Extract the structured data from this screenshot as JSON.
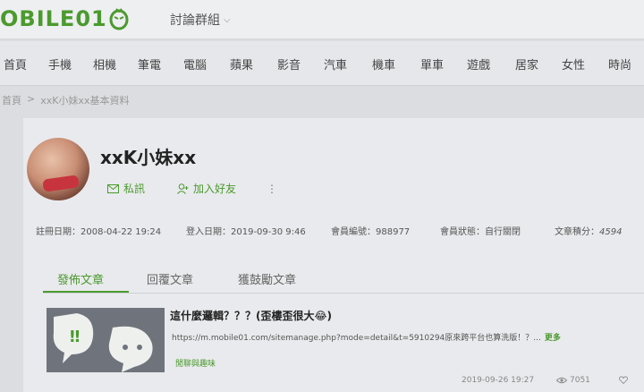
{
  "header": {
    "logo_text": "OBILE01",
    "logo_color": "#4b9a2e",
    "forum_groups_label": "討論群組"
  },
  "nav": {
    "items": [
      "首頁",
      "手機",
      "相機",
      "筆電",
      "電腦",
      "蘋果",
      "影音",
      "汽車",
      "機車",
      "單車",
      "遊戲",
      "居家",
      "女性",
      "時尚"
    ]
  },
  "breadcrumb": {
    "home": "首頁",
    "separator": ">",
    "current": "xxK小妹xx基本資料"
  },
  "profile": {
    "username": "xxK小妹xx",
    "message_label": "私訊",
    "add_friend_label": "加入好友",
    "more_label": "⋮"
  },
  "stats": {
    "register": "註冊日期：2008-04-22 19:24",
    "login": "登入日期：2019-09-30 9:46",
    "member_id": "會員編號：988977",
    "status": "會員狀態：自行關閉",
    "score_label": "文章積分：",
    "score_value": "4594"
  },
  "tabs": {
    "items": [
      "發佈文章",
      "回覆文章",
      "獲鼓勵文章"
    ],
    "active": "發佈文章"
  },
  "post": {
    "title": "這什麼邏輯？？？(歪樓歪很大😂)",
    "excerpt": "https://m.mobile01.com/sitemanage.php?mode=detail&t=5910294原來跨平台也算洗版！？...",
    "more": "更多",
    "tag": "閒聊與趣味",
    "date": "2019-09-26 19:27",
    "views": "7051"
  }
}
